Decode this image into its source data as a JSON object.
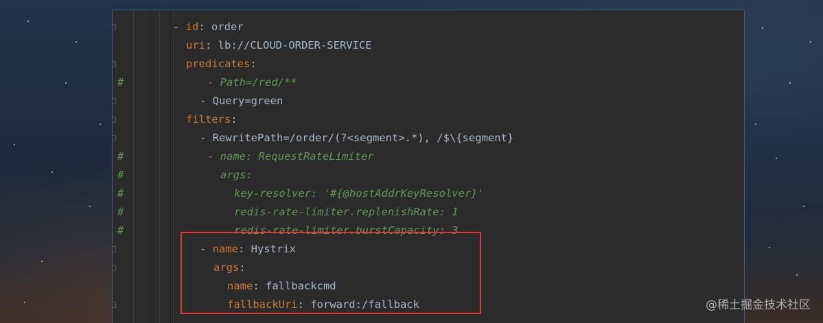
{
  "code": {
    "lines": [
      {
        "comment": false,
        "parts": [
          {
            "t": "- ",
            "c": "plain"
          },
          {
            "t": "id",
            "c": "key"
          },
          {
            "t": ": order",
            "c": "plain"
          }
        ]
      },
      {
        "comment": false,
        "parts": [
          {
            "t": "uri",
            "c": "key"
          },
          {
            "t": ": lb://CLOUD-ORDER-SERVICE",
            "c": "plain"
          }
        ]
      },
      {
        "comment": false,
        "parts": [
          {
            "t": "predicates",
            "c": "key"
          },
          {
            "t": ":",
            "c": "plain"
          }
        ]
      },
      {
        "comment": true,
        "parts": [
          {
            "t": "- Path=/red/**",
            "c": "cmt"
          }
        ]
      },
      {
        "comment": false,
        "parts": [
          {
            "t": "- Query=green",
            "c": "plain"
          }
        ]
      },
      {
        "comment": false,
        "parts": [
          {
            "t": "filters",
            "c": "key"
          },
          {
            "t": ":",
            "c": "plain"
          }
        ]
      },
      {
        "comment": false,
        "parts": [
          {
            "t": "- RewritePath=/order/(?<segment>.*), /$\\{segment}",
            "c": "plain"
          }
        ]
      },
      {
        "comment": true,
        "parts": [
          {
            "t": "- name: RequestRateLimiter",
            "c": "cmt"
          }
        ]
      },
      {
        "comment": true,
        "parts": [
          {
            "t": "args:",
            "c": "cmt"
          }
        ]
      },
      {
        "comment": true,
        "parts": [
          {
            "t": "key-resolver: '#{@hostAddrKeyResolver}'",
            "c": "cmt"
          }
        ]
      },
      {
        "comment": true,
        "parts": [
          {
            "t": "redis-rate-limiter.replenishRate: 1",
            "c": "cmt"
          }
        ]
      },
      {
        "comment": true,
        "parts": [
          {
            "t": "redis-rate-limiter.burstCapacity: 3",
            "c": "cmt"
          }
        ]
      },
      {
        "comment": false,
        "parts": [
          {
            "t": "- ",
            "c": "plain"
          },
          {
            "t": "name",
            "c": "key"
          },
          {
            "t": ": Hystrix",
            "c": "plain"
          }
        ]
      },
      {
        "comment": false,
        "parts": [
          {
            "t": "args",
            "c": "key"
          },
          {
            "t": ":",
            "c": "plain"
          }
        ]
      },
      {
        "comment": false,
        "parts": [
          {
            "t": "name",
            "c": "key"
          },
          {
            "t": ": fallbackcmd",
            "c": "plain"
          }
        ]
      },
      {
        "comment": false,
        "parts": [
          {
            "t": "fallbackUri",
            "c": "key"
          },
          {
            "t": ": forward:/fallback",
            "c": "plain"
          }
        ]
      }
    ],
    "comment_marker": "#"
  },
  "watermark": "@稀土掘金技术社区",
  "colors": {
    "editor_bg": "#2b2b2b",
    "key": "#cc7832",
    "text": "#a9b7c6",
    "comment": "#629755",
    "highlight_border": "#e0383e"
  }
}
